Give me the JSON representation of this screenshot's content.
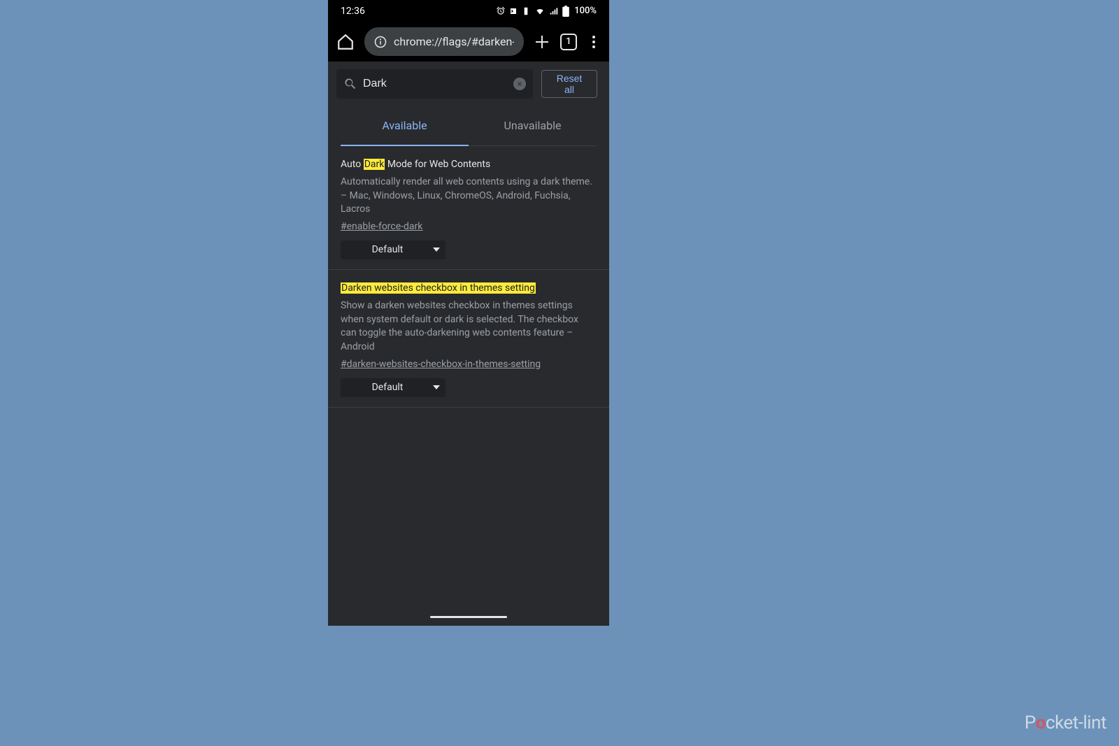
{
  "statusBar": {
    "time": "12:36",
    "batteryPct": "100%"
  },
  "browser": {
    "url": "chrome://flags/#darken-",
    "tabCount": "1"
  },
  "search": {
    "query": "Dark",
    "resetLabel": "Reset all"
  },
  "tabs": {
    "available": "Available",
    "unavailable": "Unavailable"
  },
  "flags": [
    {
      "titlePre": "Auto ",
      "titleHL": "Dark",
      "titlePost": " Mode for Web Contents",
      "desc": "Automatically render all web contents using a dark theme. – Mac, Windows, Linux, ChromeOS, Android, Fuchsia, Lacros",
      "id": "#enable-force-dark",
      "select": "Default"
    },
    {
      "titlePre": "",
      "titleHL": "Darken websites checkbox in themes setting",
      "titlePost": "",
      "desc": "Show a darken websites checkbox in themes settings when system default or dark is selected. The checkbox can toggle the auto-darkening web contents feature – Android",
      "id": "#darken-websites-checkbox-in-themes-setting",
      "select": "Default"
    }
  ],
  "watermark": {
    "pre": "P",
    "pwr": "o",
    "post": "cket-lint"
  }
}
